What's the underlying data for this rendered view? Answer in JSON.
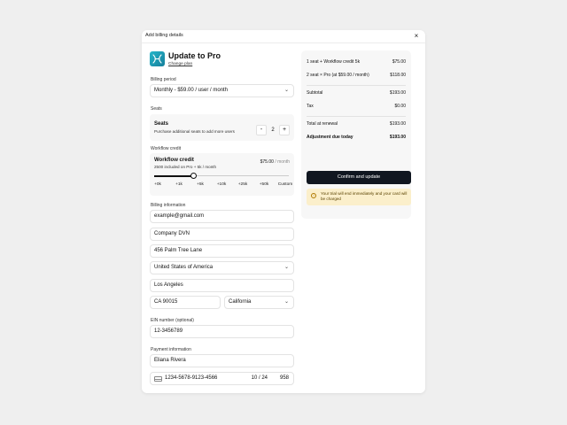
{
  "modal": {
    "title": "Add billing details",
    "close_glyph": "×"
  },
  "plan": {
    "title": "Update to Pro",
    "change_label": "Change plan",
    "icon": "app-logo-icon",
    "icon_color": "#1f9fb8"
  },
  "billing_period": {
    "label": "Billing period",
    "value": "Monthly - $59.00 / user / month"
  },
  "seats": {
    "section_label": "Seats",
    "title": "Seats",
    "description": "Purchase additional seats to add more users",
    "minus": "-",
    "plus": "+",
    "value": "2"
  },
  "workflow": {
    "section_label": "Workflow credit",
    "title": "Workflow credit",
    "description": "2500 included on Pro + 5k / month",
    "price": "$75.00",
    "price_unit": "/ month",
    "slider_value_fraction": 0.29,
    "ticks": [
      "+0k",
      "+1k",
      "+5k",
      "+10k",
      "+25k",
      "+50k",
      "Custom"
    ]
  },
  "billing_info": {
    "label": "Billing information",
    "email": "example@gmail.com",
    "company": "Company DVN",
    "address": "456 Palm Tree Lane",
    "country": "United States of America",
    "city": "Los Angeles",
    "zip": "CA 90015",
    "state": "California"
  },
  "ein": {
    "label": "EIN number (optional)",
    "value": "12-3456789"
  },
  "payment": {
    "label": "Payment information",
    "name": "Eliana Rivera",
    "card_number": "1234-5678-9123-4566",
    "expiry": "10 / 24",
    "cvc": "958",
    "card_icon": "credit-card-icon"
  },
  "summary": {
    "line1_label": "1 seat + Workflow credit 5k",
    "line1_value": "$75.00",
    "line2_label": "2 seat × Pro (at $59.00 / month)",
    "line2_value": "$118.00",
    "subtotal_label": "Subtotal",
    "subtotal_value": "$193.00",
    "tax_label": "Tax",
    "tax_value": "$0.00",
    "renewal_label": "Total at renewal",
    "renewal_value": "$193.00",
    "due_label": "Adjustment due today",
    "due_value": "$193.00",
    "confirm_label": "Confirm and update",
    "trial_note": "Your trial will end immediately and your card will be charged",
    "warn_glyph": "!"
  },
  "colors": {
    "accent": "#101620",
    "warning_bg": "#fbefcb",
    "page_bg": "#efefef"
  }
}
